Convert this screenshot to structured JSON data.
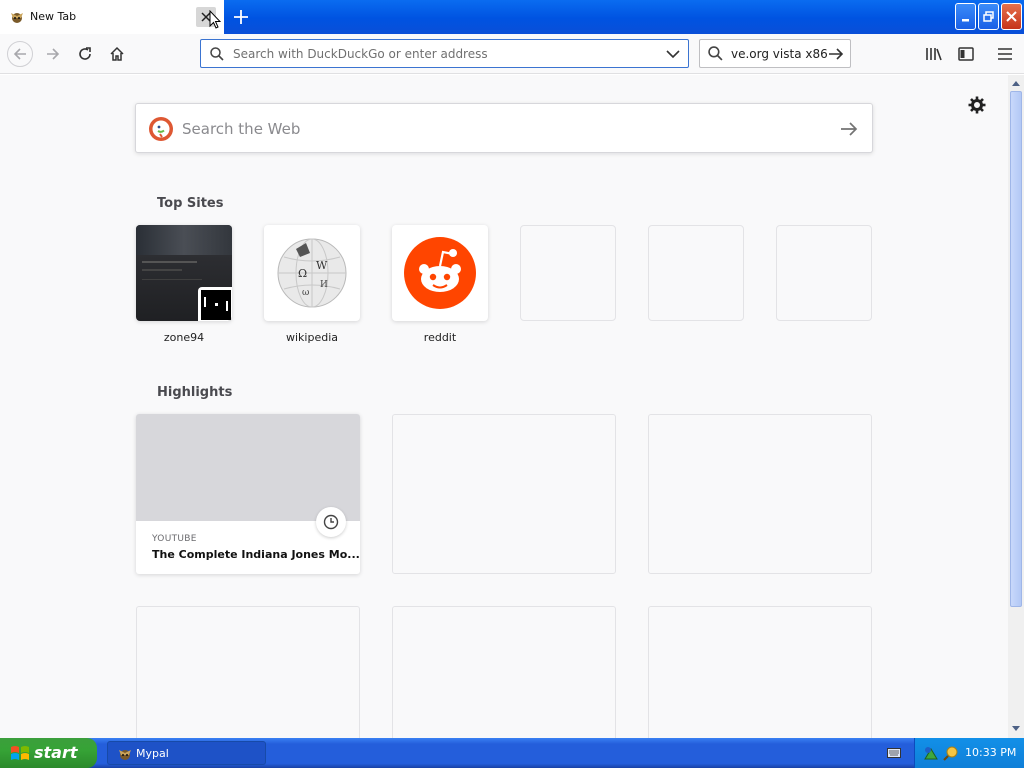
{
  "browser": {
    "tab": {
      "title": "New Tab"
    },
    "url_placeholder": "Search with DuckDuckGo or enter address",
    "search_value": "ve.org vista x86"
  },
  "newtab": {
    "search_placeholder": "Search the Web",
    "top_sites_title": "Top Sites",
    "top_sites": [
      {
        "label": "zone94"
      },
      {
        "label": "wikipedia"
      },
      {
        "label": "reddit"
      }
    ],
    "highlights_title": "Highlights",
    "highlight": {
      "source": "YOUTUBE",
      "title": "The Complete Indiana Jones Mo..."
    }
  },
  "taskbar": {
    "start_label": "start",
    "items": [
      {
        "label": "Mypal"
      }
    ],
    "clock": "10:33 PM"
  },
  "colors": {
    "accent_blue": "#0a59e0",
    "reddit": "#ff4500",
    "ddg": "#de5833",
    "start_green": "#36a336"
  }
}
